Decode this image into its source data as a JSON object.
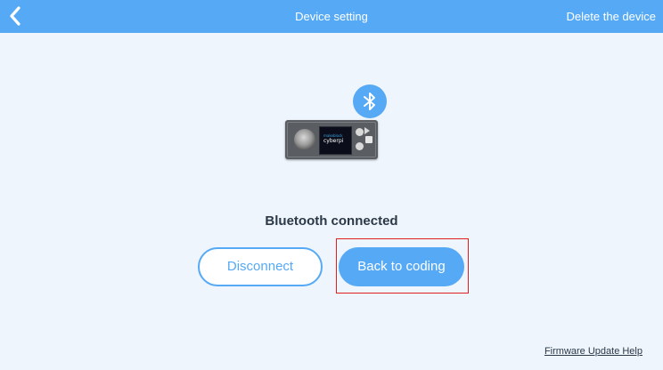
{
  "header": {
    "title": "Device setting",
    "delete_label": "Delete the device",
    "back_icon": "chevron-left-icon"
  },
  "device": {
    "brand_text": "makeblock",
    "model_text": "cyberpi",
    "badge_icon": "bluetooth-icon"
  },
  "status": {
    "text": "Bluetooth connected"
  },
  "actions": {
    "disconnect_label": "Disconnect",
    "back_to_coding_label": "Back to coding"
  },
  "footer": {
    "firmware_help_label": "Firmware Update Help"
  },
  "colors": {
    "accent": "#55a9f5",
    "background": "#eef5fd",
    "highlight": "#e02020",
    "text_dark": "#2b3847"
  }
}
